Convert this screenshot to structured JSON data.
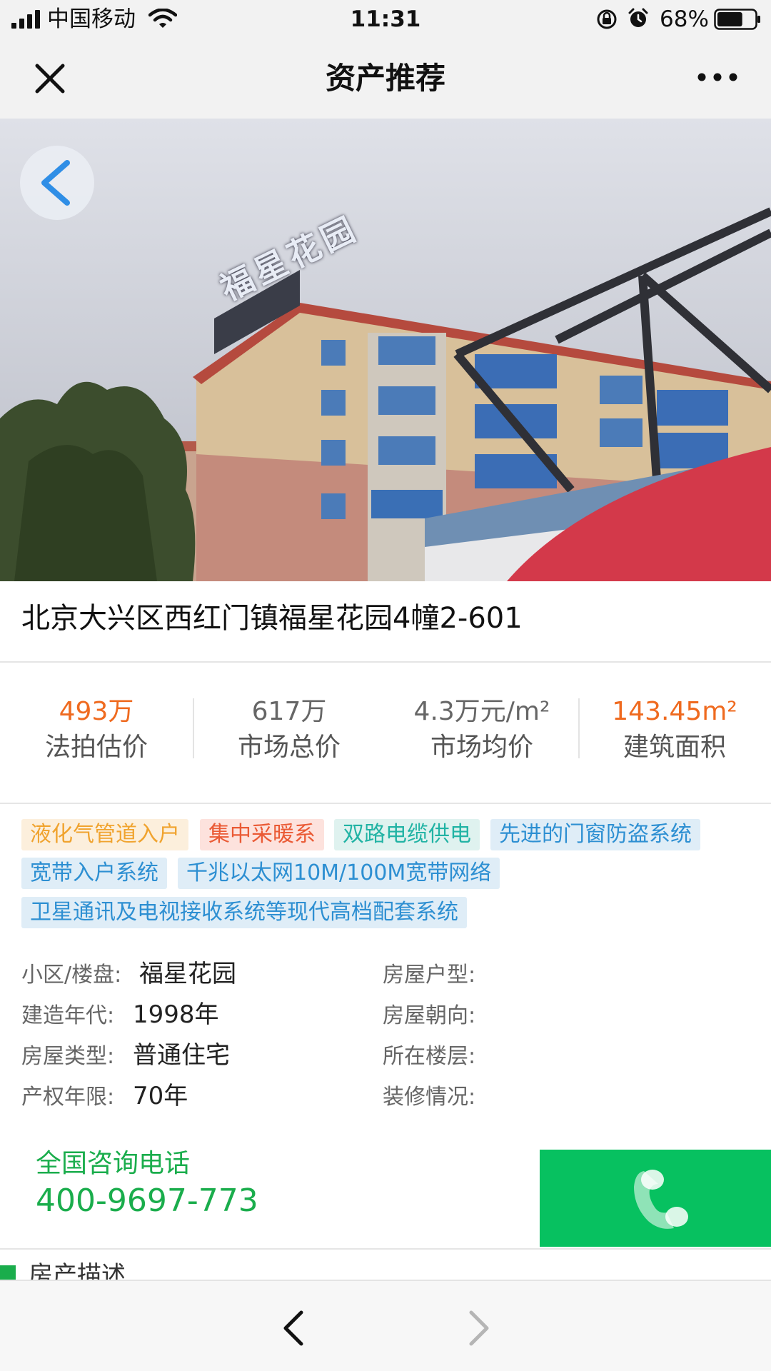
{
  "status_bar": {
    "carrier": "中国移动",
    "time": "11:31",
    "battery": "68%",
    "battery_level": 0.68
  },
  "nav": {
    "title": "资产推荐"
  },
  "hero": {
    "sign_text": "福星花园"
  },
  "listing": {
    "address": "北京大兴区西红门镇福星花园4幢2-601"
  },
  "stats": [
    {
      "value": "493万",
      "label": "法拍估价",
      "highlight": true
    },
    {
      "value": "617万",
      "label": "市场总价",
      "highlight": false
    },
    {
      "value": "4.3万元/m²",
      "label": "市场均价",
      "highlight": false
    },
    {
      "value": "143.45m²",
      "label": "建筑面积",
      "highlight": true
    }
  ],
  "tags": [
    {
      "text": "液化气管道入户",
      "color": "yellow"
    },
    {
      "text": "集中采暖系",
      "color": "red"
    },
    {
      "text": "双路电缆供电",
      "color": "teal"
    },
    {
      "text": "先进的门窗防盗系统",
      "color": "blue"
    },
    {
      "text": "宽带入户系统",
      "color": "blue"
    },
    {
      "text": "千兆以太网10M/100M宽带网络",
      "color": "blue"
    },
    {
      "text": "卫星通讯及电视接收系统等现代高档配套系统",
      "color": "blue"
    }
  ],
  "property_info": {
    "left": [
      {
        "label": "小区/楼盘:",
        "value": "福星花园"
      },
      {
        "label": "建造年代:",
        "value": "1998年"
      },
      {
        "label": "房屋类型:",
        "value": "普通住宅"
      },
      {
        "label": "产权年限:",
        "value": "70年"
      }
    ],
    "right": [
      {
        "label": "房屋户型:",
        "value": ""
      },
      {
        "label": "房屋朝向:",
        "value": ""
      },
      {
        "label": "所在楼层:",
        "value": ""
      },
      {
        "label": "装修情况:",
        "value": ""
      }
    ]
  },
  "contact": {
    "label": "全国咨询电话",
    "phone": "400-9697-773"
  },
  "section": {
    "title": "房产描述"
  },
  "colors": {
    "accent_green": "#07c160",
    "text_green": "#1aad4c",
    "orange": "#ef6a1f",
    "back_blue": "#2f8ee6"
  },
  "icons": {
    "close": "close-icon",
    "more": "more-icon",
    "back": "chevron-left-icon",
    "call": "phone-icon",
    "nav_back": "chevron-left-icon",
    "nav_forward": "chevron-right-icon"
  }
}
